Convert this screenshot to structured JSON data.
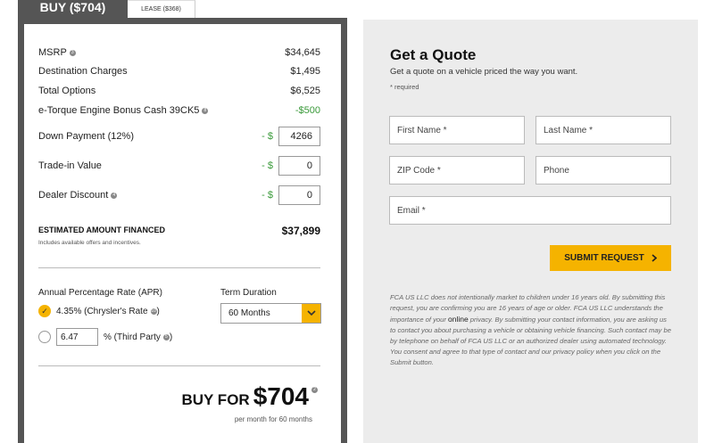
{
  "tabs": {
    "buy_label": "BUY ($704)",
    "lease_label": "LEASE ($368)"
  },
  "pricing": {
    "msrp_label": "MSRP",
    "msrp_info": "3",
    "msrp_value": "$34,645",
    "destination_label": "Destination Charges",
    "destination_value": "$1,495",
    "options_label": "Total Options",
    "options_value": "$6,525",
    "bonus_label": "e-Torque Engine Bonus Cash 39CK5",
    "bonus_info": "8",
    "bonus_value": "-$500",
    "down_label": "Down Payment (12%)",
    "down_prefix": "- $",
    "down_value": "4266",
    "tradein_label": "Trade-in Value",
    "tradein_prefix": "- $",
    "tradein_value": "0",
    "dealer_label": "Dealer Discount",
    "dealer_info": "4",
    "dealer_prefix": "- $",
    "dealer_value": "0",
    "financed_label": "ESTIMATED AMOUNT FINANCED",
    "financed_sub": "Includes available offers and incentives.",
    "financed_value": "$37,899"
  },
  "apr": {
    "label": "Annual Percentage Rate (APR)",
    "option1": "4.35% (Chrysler's Rate",
    "option1_info": "10",
    "option1_close": ")",
    "custom_value": "6.47",
    "option2": "% (Third Party",
    "option2_info": "5",
    "option2_close": ")"
  },
  "term": {
    "label": "Term Duration",
    "selected": "60 Months"
  },
  "summary": {
    "buy_for_label": "BUY FOR",
    "buy_for_value": "$704",
    "buy_for_info": "2",
    "per_month": "per month for 60 months"
  },
  "quote": {
    "title": "Get a Quote",
    "subtitle": "Get a quote on a vehicle priced the way you want.",
    "required": "* required",
    "first_name_placeholder": "First Name *",
    "last_name_placeholder": "Last Name *",
    "zip_placeholder": "ZIP Code *",
    "phone_placeholder": "Phone",
    "email_placeholder": "Email *",
    "submit_label": "SUBMIT REQUEST",
    "disclaimer_part1": "FCA US LLC does not intentionally market to children under 16 years old. By submitting this request, you are confirming you are 16 years of age or older. FCA US LLC understands the importance of your ",
    "disclaimer_online": "online",
    "disclaimer_part2": " privacy. By submitting your contact information, you are asking us to contact you about purchasing a vehicle or obtaining vehicle financing. Such contact may be by telephone on behalf of FCA US LLC or an authorized dealer using automated technology. You consent and agree to that type of contact and our privacy policy when you click on the Submit button."
  },
  "colors": {
    "accent": "#f5b300",
    "frame": "#555555",
    "panel": "#ececec",
    "credit": "#3a9a3a"
  }
}
